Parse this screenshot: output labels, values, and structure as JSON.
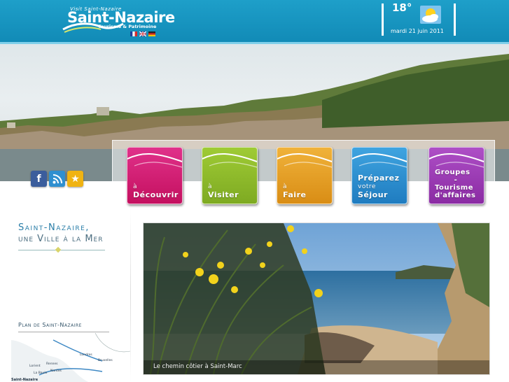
{
  "header": {
    "logo_small": "Visit Saint-Nazaire",
    "logo_name": "Saint-Nazaire",
    "logo_sub": "Tourisme & Patrimoine",
    "flags": [
      "flag-fr-icon",
      "flag-uk-icon",
      "flag-de-icon"
    ]
  },
  "weather": {
    "temperature": "18°",
    "date": "mardi 21 juin 2011",
    "icon": "sun-cloud-icon"
  },
  "social": [
    "facebook-icon",
    "rss-icon",
    "favorite-star-icon"
  ],
  "nav": [
    {
      "line1": "à",
      "line2": "Découvrir",
      "color": "#d4146e"
    },
    {
      "line1": "à",
      "line2": "Visiter",
      "color": "#8bb82a"
    },
    {
      "line1": "à",
      "line2": "Faire",
      "color": "#e8a021"
    },
    {
      "line1": "Préparez",
      "line2": "votre",
      "line3": "Séjour",
      "color": "#2a8fd0"
    },
    {
      "line1": "Groupes",
      "line2": "-",
      "line3": "Tourisme",
      "line4": "d'affaires",
      "color": "#9a3bb2"
    }
  ],
  "sidebar": {
    "title_line1": "Saint-Nazaire,",
    "title_line2": "une Ville à la Mer",
    "plan_title": "Plan de Saint-Nazaire",
    "map_labels": [
      "Saint-Nazaire",
      "Lorient",
      "Rennes",
      "Nantes",
      "La Baule",
      "Londres",
      "Bruxelles"
    ]
  },
  "photo": {
    "caption": "Le chemin côtier à Saint-Marc"
  }
}
